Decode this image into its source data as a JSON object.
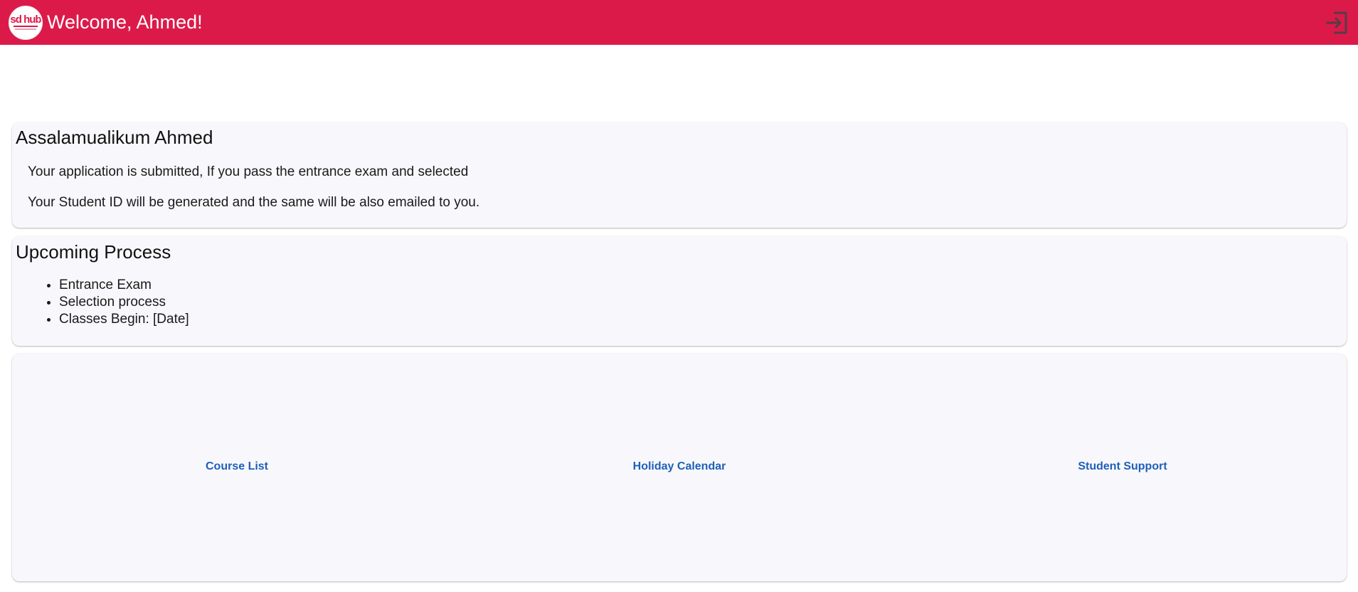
{
  "header": {
    "logo_text": "sd hub",
    "welcome": "Welcome, Ahmed!",
    "logout_icon": "logout-icon",
    "bg_color": "#dc1a4a"
  },
  "greeting_card": {
    "title": "Assalamualikum Ahmed",
    "line1": "Your application is submitted, If you pass the entrance exam and selected",
    "line2": "Your Student ID will be generated and the same will be also emailed to you."
  },
  "process_card": {
    "title": "Upcoming Process",
    "items": [
      {
        "label": "Entrance Exam"
      },
      {
        "label": "Selection process"
      },
      {
        "label": "Classes Begin: [Date]"
      }
    ]
  },
  "links_card": {
    "course_list": "Course List",
    "holiday_calendar": "Holiday Calendar",
    "student_support": "Student Support",
    "link_color": "#1f5fb8"
  }
}
